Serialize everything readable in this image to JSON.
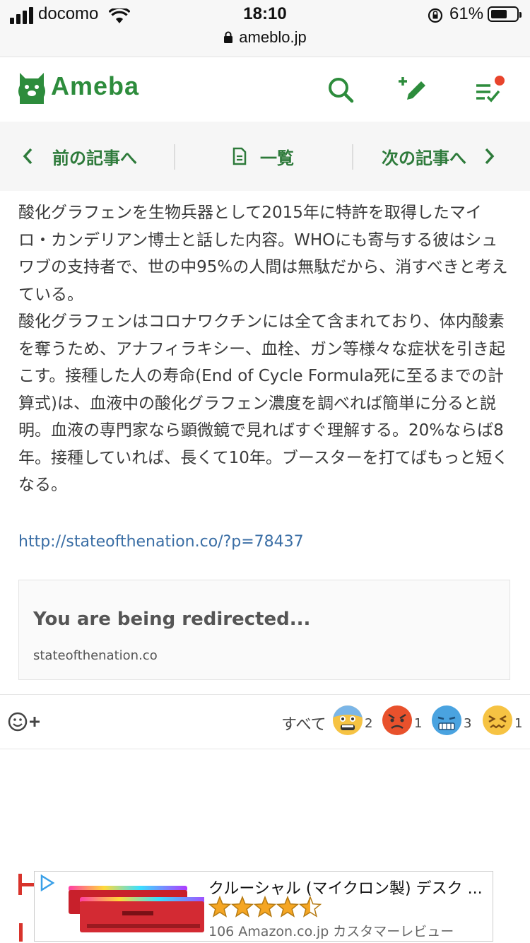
{
  "status": {
    "carrier": "docomo",
    "time": "18:10",
    "battery_percent": "61%",
    "battery_level": 0.61,
    "url": "ameblo.jp"
  },
  "header": {
    "logo_text": "Ameba",
    "icons": [
      "search-icon",
      "edit-blog-icon",
      "checklist-icon"
    ],
    "accent_color": "#2d8c3c",
    "notification_color": "#e8442c"
  },
  "nav": {
    "prev_label": "前の記事へ",
    "list_label": "一覧",
    "next_label": "次の記事へ"
  },
  "article": {
    "body": "酸化グラフェンを生物兵器として2015年に特許を取得したマイロ・カンデリアン博士と話した内容。WHOにも寄与する彼はシュワブの支持者で、世の中95%の人間は無駄だから、消すべきと考えている。\n酸化グラフェンはコロナワクチンには全て含まれており、体内酸素を奪うため、アナフィラキシー、血栓、ガン等様々な症状を引き起こす。接種した人の寿命(End of Cycle Formula死に至るまでの計算式)は、血液中の酸化グラフェン濃度を調べれば簡単に分ると説明。血液の専門家なら顕微鏡で見ればすぐ理解する。20%ならば8年。接種していれば、長くて10年。ブースターを打てばもっと短くなる。",
    "link": "http://stateofthenation.co/?p=78437",
    "card_title": "You are being redirected...",
    "card_domain": "stateofthenation.co"
  },
  "reactions": {
    "all_label": "すべて",
    "items": [
      {
        "icon": "fearful-face-icon",
        "count": "2",
        "color": "#f6c343"
      },
      {
        "icon": "angry-face-icon",
        "count": "1",
        "color": "#e8512c"
      },
      {
        "icon": "freezing-face-icon",
        "count": "3",
        "color": "#4aa3e0"
      },
      {
        "icon": "confounded-face-icon",
        "count": "1",
        "color": "#f6c343"
      }
    ]
  },
  "ad": {
    "title": "クルーシャル (マイクロン製) デスク ...",
    "rating": 4.5,
    "review_text": "106 Amazon.co.jp カスタマーレビュー"
  }
}
